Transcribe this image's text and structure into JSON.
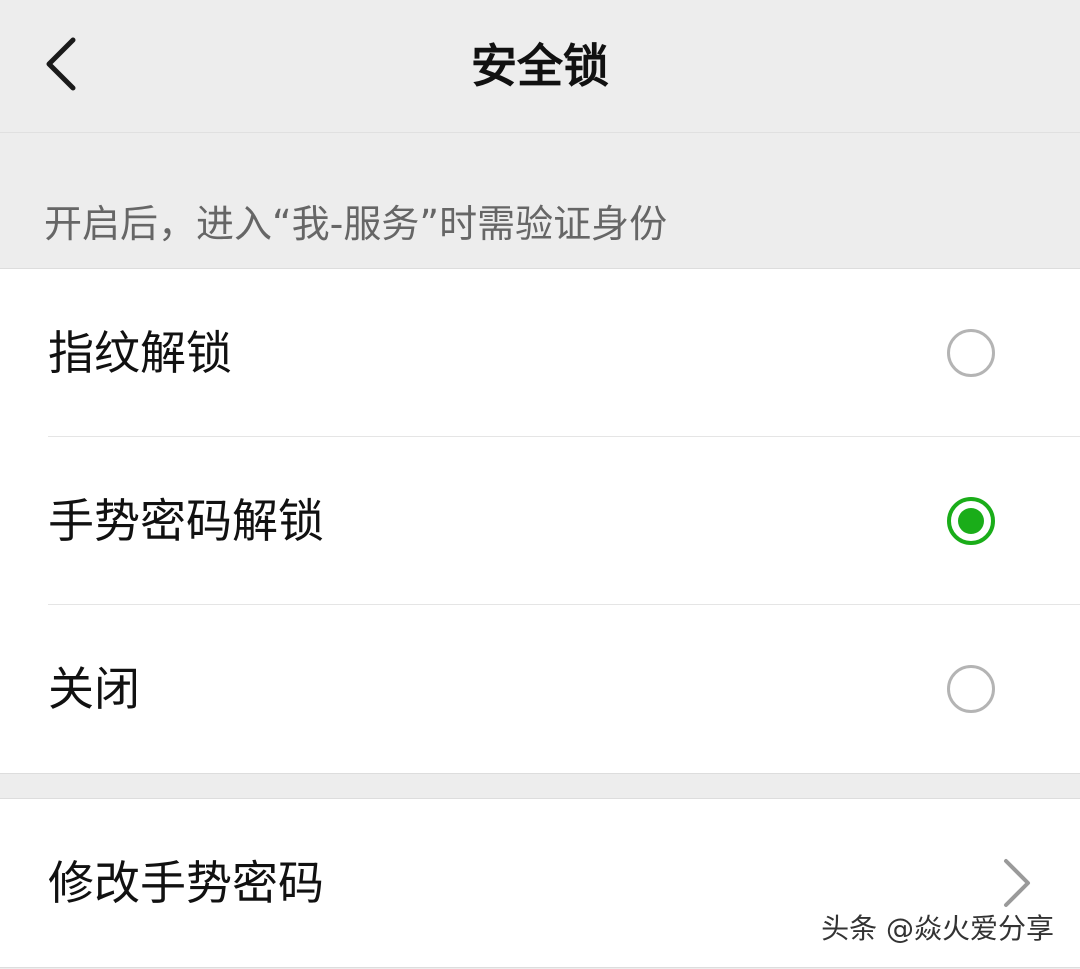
{
  "header": {
    "title": "安全锁",
    "back_icon": "chevron-left-icon"
  },
  "hint": "开启后，进入“我-服务”时需验证身份",
  "options": [
    {
      "label": "指纹解锁",
      "selected": false
    },
    {
      "label": "手势密码解锁",
      "selected": true
    },
    {
      "label": "关闭",
      "selected": false
    }
  ],
  "change_gesture": {
    "label": "修改手势密码",
    "icon": "chevron-right-icon"
  },
  "watermark": "头条 @焱火爱分享",
  "colors": {
    "accent": "#1aad19",
    "background": "#ededed",
    "card": "#ffffff",
    "radio_unchecked": "#b4b4b4"
  }
}
